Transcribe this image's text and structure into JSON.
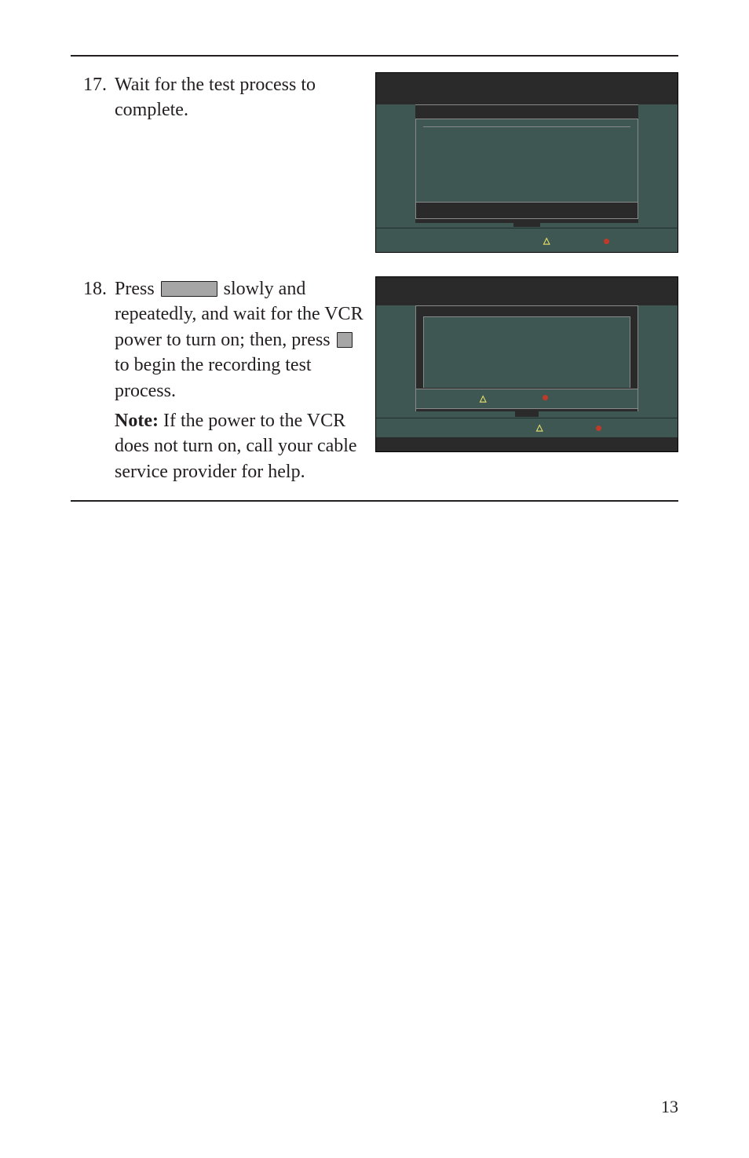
{
  "page_number": "13",
  "steps": [
    {
      "number": "17.",
      "paragraphs": [
        {
          "type": "plain",
          "text": "Wait for the test process to complete."
        }
      ]
    },
    {
      "number": "18.",
      "paragraphs": [
        {
          "type": "press_long",
          "a": "Press ",
          "b": " slowly and repeatedly, and wait for the VCR power to turn on; then, press ",
          "c": " to begin the recording test process."
        },
        {
          "type": "note",
          "label": "Note:",
          "text": " If the power to the VCR does not turn on, call your cable service provider for help."
        }
      ]
    }
  ]
}
